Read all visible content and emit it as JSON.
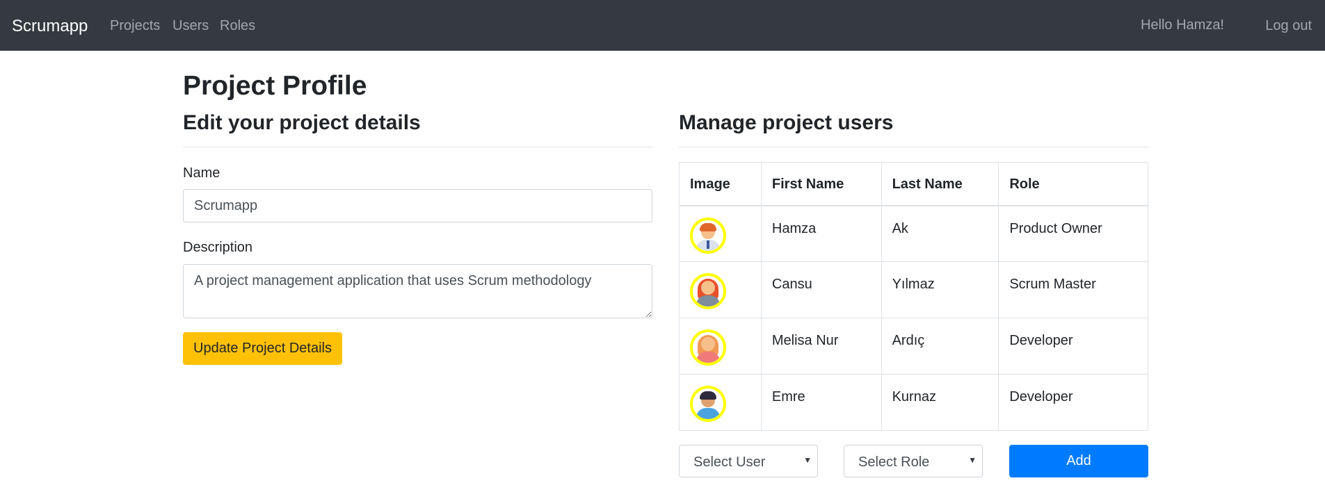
{
  "navbar": {
    "brand": "Scrumapp",
    "links": [
      "Projects",
      "Users",
      "Roles"
    ],
    "greeting": "Hello Hamza!",
    "logout_label": "Log out"
  },
  "page": {
    "title": "Project Profile"
  },
  "details": {
    "title": "Edit your project details",
    "name_label": "Name",
    "name_value": "Scrumapp",
    "description_label": "Description",
    "description_value": "A project management application that uses Scrum methodology",
    "update_label": "Update Project Details"
  },
  "users": {
    "title": "Manage project users",
    "columns": [
      "Image",
      "First Name",
      "Last Name",
      "Role"
    ],
    "rows": [
      {
        "avatar": "man-with-tie-avatar",
        "first_name": "Hamza",
        "last_name": "Ak",
        "role": "Product Owner"
      },
      {
        "avatar": "woman-red-hair-avatar",
        "first_name": "Cansu",
        "last_name": "Yılmaz",
        "role": "Scrum Master"
      },
      {
        "avatar": "girl-avatar",
        "first_name": "Melisa Nur",
        "last_name": "Ardıç",
        "role": "Developer"
      },
      {
        "avatar": "man-dark-hair-avatar",
        "first_name": "Emre",
        "last_name": "Kurnaz",
        "role": "Developer"
      }
    ],
    "select_user": "Select User",
    "select_role": "Select Role",
    "add_label": "Add"
  },
  "colors": {
    "navbar": "#343a40",
    "update_button": "#ffc107",
    "add_button": "#007bff",
    "avatar_ring": "#ffff00"
  }
}
